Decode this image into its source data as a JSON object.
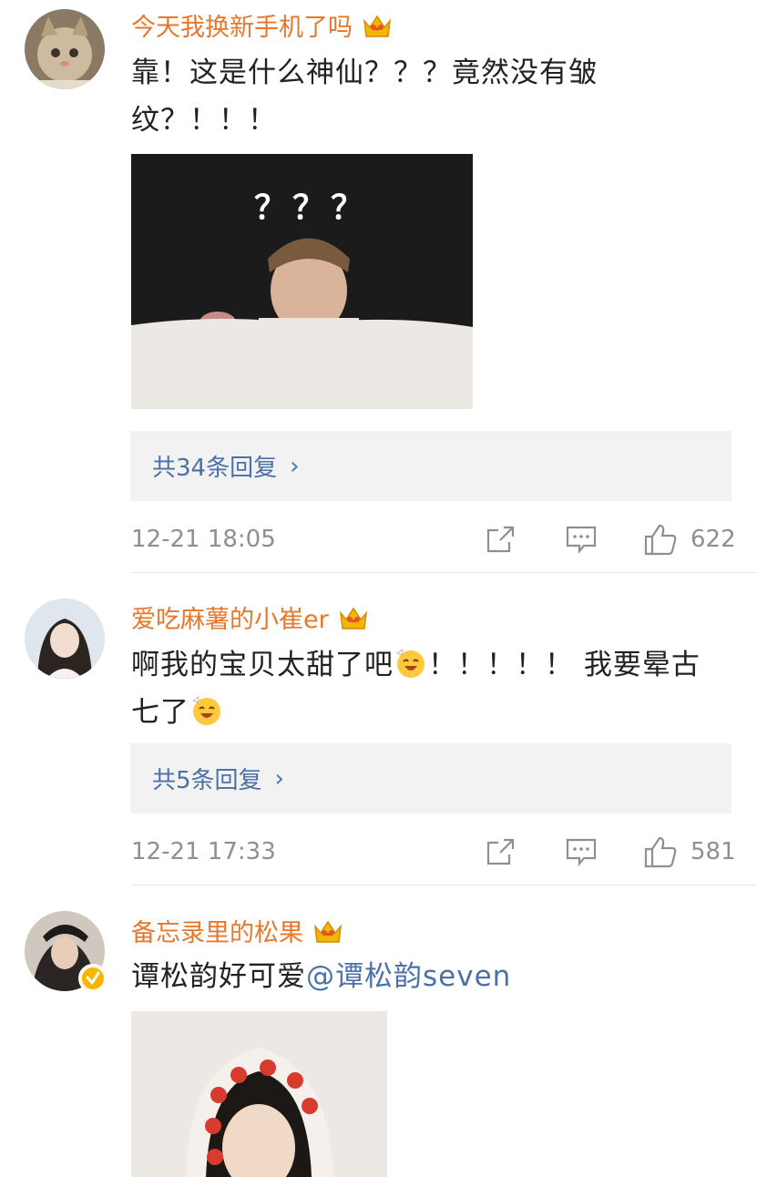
{
  "comments": [
    {
      "username": "今天我换新手机了吗",
      "text_line1": "靠！这是什么神仙？？？竟然没有皱",
      "text_line2": "纹？！！！",
      "image_caption": "？？？",
      "reply_label": "共34条回复",
      "time": "12-21 18:05",
      "likes": "622"
    },
    {
      "username": "爱吃麻薯的小崔er",
      "text_line1_a": "啊我的宝贝太甜了吧",
      "text_line1_b": "！！！！！ 我要晕古",
      "text_line2": "七了",
      "reply_label": "共5条回复",
      "time": "12-21 17:33",
      "likes": "581"
    },
    {
      "username": "备忘录里的松果",
      "text_plain": "谭松韵好可爱",
      "mention": "@谭松韵seven"
    }
  ],
  "icons": {
    "share": "share-icon",
    "comment": "comment-icon",
    "like": "like-icon",
    "crown": "crown-badge-icon",
    "verified": "verified-badge-icon"
  },
  "colors": {
    "username": "#e8772a",
    "link": "#4a72a8",
    "meta": "#8f8f8f",
    "reply_bg": "#f2f2f2"
  }
}
